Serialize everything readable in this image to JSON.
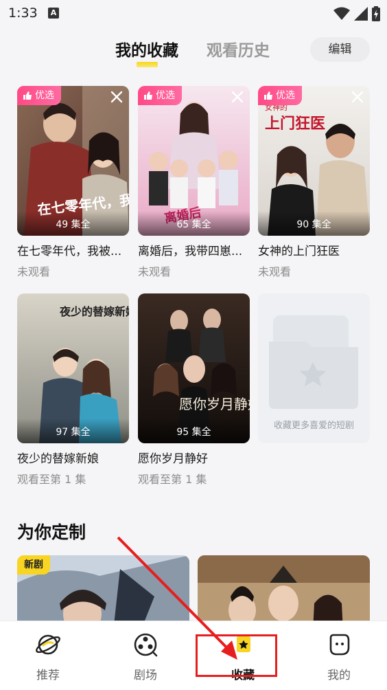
{
  "status_bar": {
    "time": "1:33",
    "sim_label": "A"
  },
  "tabs": {
    "favorites": "我的收藏",
    "history": "观看历史",
    "edit": "编辑"
  },
  "badges": {
    "featured": "优选",
    "new": "新剧"
  },
  "favorites": [
    {
      "title": "在七零年代，我被...",
      "episodes": "49 集全",
      "progress": "未观看",
      "poster_text": "在七零年代，我被宠了"
    },
    {
      "title": "离婚后，我带四崽...",
      "episodes": "65 集全",
      "progress": "未观看",
      "poster_text": "离婚后"
    },
    {
      "title": "女神的上门狂医",
      "episodes": "90 集全",
      "progress": "未观看",
      "poster_text": "上门狂医",
      "poster_subtext": "女神的"
    },
    {
      "title": "夜少的替嫁新娘",
      "episodes": "97 集全",
      "progress": "观看至第 1 集",
      "poster_text": "夜少的替嫁新娘"
    },
    {
      "title": "愿你岁月静好",
      "episodes": "95 集全",
      "progress": "观看至第 1 集",
      "poster_text": "愿你岁月静好"
    }
  ],
  "empty_hint": "收藏更多喜爱的短剧",
  "section_title": "为你定制",
  "bottom_nav": [
    {
      "label": "推荐",
      "icon": "planet-icon"
    },
    {
      "label": "剧场",
      "icon": "film-reel-icon"
    },
    {
      "label": "收藏",
      "icon": "star-bookmark-icon",
      "active": true
    },
    {
      "label": "我的",
      "icon": "face-icon"
    }
  ],
  "colors": {
    "accent": "#f8d522",
    "featured_badge": "#ff4a86",
    "annotation": "#e81d1d"
  }
}
